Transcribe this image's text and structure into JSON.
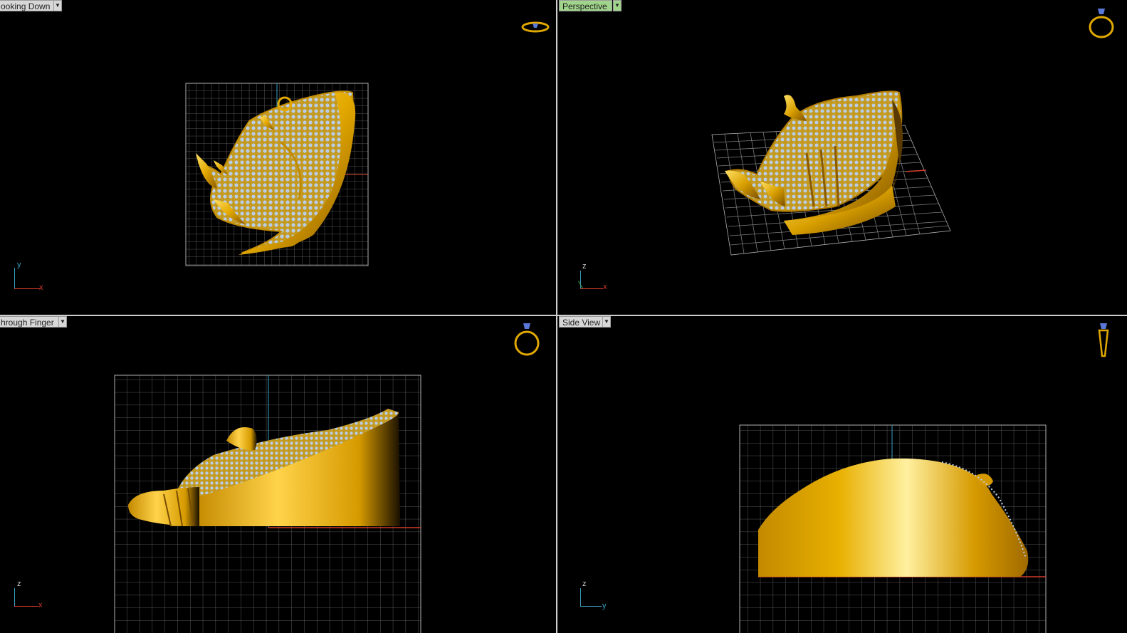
{
  "viewports": {
    "top_left": {
      "label": "ooking Down"
    },
    "top_right": {
      "label": "Perspective"
    },
    "bottom_left": {
      "label": "hrough Finger"
    },
    "bottom_right": {
      "label": "Side View"
    }
  },
  "axes": {
    "top_left": {
      "vertical": "y",
      "horizontal": "x"
    },
    "top_right": {
      "vertical": "z",
      "horizontal": "x"
    },
    "bottom_left": {
      "vertical": "z",
      "horizontal": "x"
    },
    "bottom_right": {
      "vertical": "z",
      "horizontal": "y"
    }
  },
  "colors": {
    "grid": "#8a8a8a",
    "gold": "#e0a800",
    "gold_light": "#ffd34a",
    "stone": "#b9cde8",
    "active_label": "#9fd48a",
    "axis_x": "#d03a2a",
    "axis_y": "#3aa0c0",
    "axis_z": "#3aa0c0"
  }
}
